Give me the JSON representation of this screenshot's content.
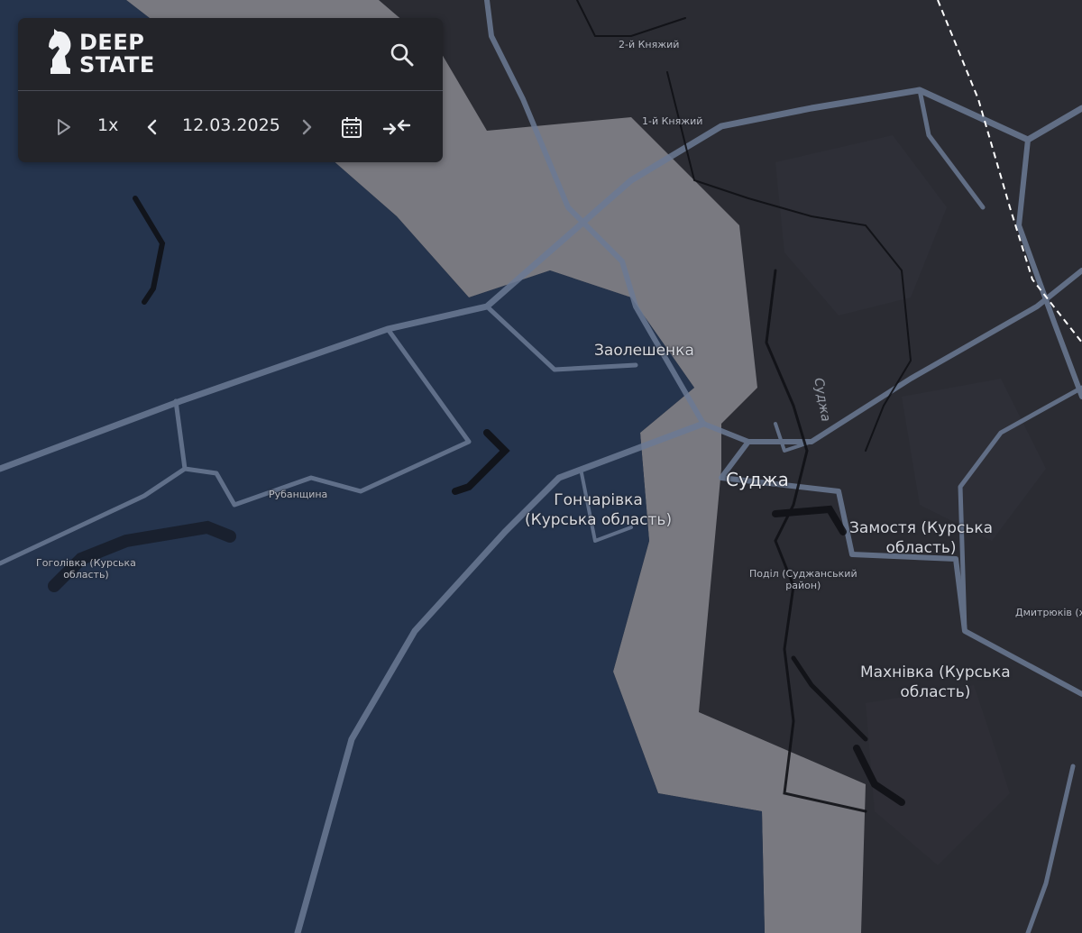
{
  "app": {
    "logo_text_line1": "DEEP",
    "logo_text_line2": "STATE"
  },
  "toolbar": {
    "speed_label": "1x",
    "date": "12.03.2025"
  },
  "icons": {
    "logo": "knight-chess-icon",
    "search": "search-icon",
    "play": "play-icon",
    "prev": "chevron-left-icon",
    "next": "chevron-right-icon",
    "calendar": "calendar-icon",
    "compare": "compare-arrows-icon"
  },
  "map": {
    "colors": {
      "base": "#2b2c33",
      "ukraine_controlled": "#25344d",
      "contested_grey": "#8f9096",
      "road": "#6b7a94",
      "river": "#101116",
      "railway": "#ffffff"
    },
    "place_labels": {
      "kniazhyi_2": "2-й Княжий",
      "kniazhyi_1": "1-й Княжий",
      "zaoleshenka": "Заолешенка",
      "sudzha": "Суджа",
      "honcharivka_line1": "Гончарівка",
      "honcharivka_line2": "(Курська область)",
      "rubanshchyna": "Рубанщина",
      "hoholivka_line1": "Гоголівка (Курська",
      "hoholivka_line2": "область)",
      "zamostia_line1": "Замостя (Курська",
      "zamostia_line2": "область)",
      "podil_line1": "Поділ (Суджанський",
      "podil_line2": "район)",
      "makhnivka_line1": "Махнівка (Курська",
      "makhnivka_line2": "область)",
      "dmytriukiv": "Дмитрюків (ху"
    },
    "river_label": "Суджа"
  }
}
